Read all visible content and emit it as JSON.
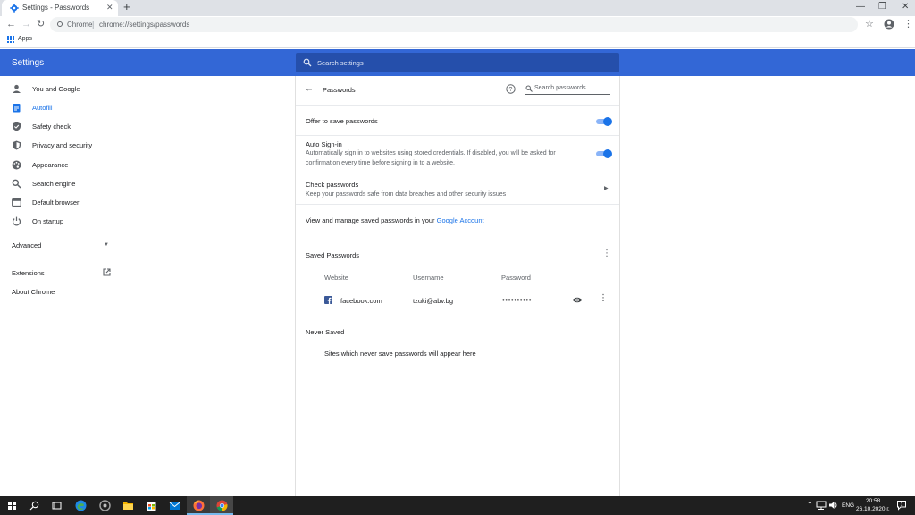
{
  "tab": {
    "title": "Settings - Passwords"
  },
  "toolbar": {
    "site_name": "Chrome",
    "url": "chrome://settings/passwords"
  },
  "bookmarks": {
    "apps_label": "Apps"
  },
  "header": {
    "title": "Settings",
    "search_placeholder": "Search settings"
  },
  "sidebar": {
    "items": [
      {
        "label": "You and Google",
        "icon": "person-icon"
      },
      {
        "label": "Autofill",
        "icon": "clipboard-icon",
        "active": true
      },
      {
        "label": "Safety check",
        "icon": "shield-check-icon"
      },
      {
        "label": "Privacy and security",
        "icon": "shield-icon"
      },
      {
        "label": "Appearance",
        "icon": "palette-icon"
      },
      {
        "label": "Search engine",
        "icon": "search-icon"
      },
      {
        "label": "Default browser",
        "icon": "browser-icon"
      },
      {
        "label": "On startup",
        "icon": "power-icon"
      }
    ],
    "advanced": "Advanced",
    "extensions": "Extensions",
    "about": "About Chrome"
  },
  "passwords": {
    "title": "Passwords",
    "search_placeholder": "Search passwords",
    "offer_to_save": "Offer to save passwords",
    "auto_signin_title": "Auto Sign-in",
    "auto_signin_desc": "Automatically sign in to websites using stored credentials. If disabled, you will be asked for confirmation every time before signing in to a website.",
    "check_title": "Check passwords",
    "check_desc": "Keep your passwords safe from data breaches and other security issues",
    "manage_text": "View and manage saved passwords in your ",
    "manage_link": "Google Account",
    "saved_heading": "Saved Passwords",
    "columns": [
      "Website",
      "Username",
      "Password"
    ],
    "entries": [
      {
        "website": "facebook.com",
        "username": "tzuki@abv.bg",
        "password": "••••••••••"
      }
    ],
    "never_saved_heading": "Never Saved",
    "never_saved_empty": "Sites which never save passwords will appear here",
    "toggles": {
      "offer_to_save": true,
      "auto_signin": true
    }
  },
  "taskbar": {
    "language": "ENG",
    "time": "20:58",
    "date": "26.10.2020 г."
  },
  "colors": {
    "accent": "#1a73e8",
    "header": "#3367d6",
    "taskbar": "#1f1f1f"
  }
}
